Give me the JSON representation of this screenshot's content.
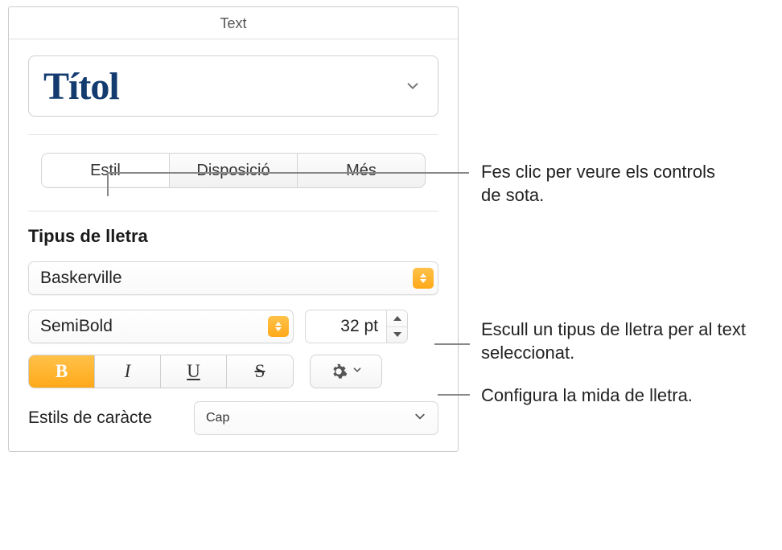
{
  "header": "Text",
  "paragraph_style": "Títol",
  "tabs": {
    "style": "Estil",
    "layout": "Disposició",
    "more": "Més"
  },
  "font": {
    "section_label": "Tipus de lletra",
    "family": "Baskerville",
    "weight": "SemiBold",
    "size": "32 pt"
  },
  "character_styles": {
    "label": "Estils de caràcte",
    "value": "Cap"
  },
  "callouts": {
    "tabs": "Fes clic per veure els controls de sota.",
    "font_family": "Escull un tipus de lletra per al text seleccionat.",
    "font_size": "Configura la mida de lletra."
  }
}
